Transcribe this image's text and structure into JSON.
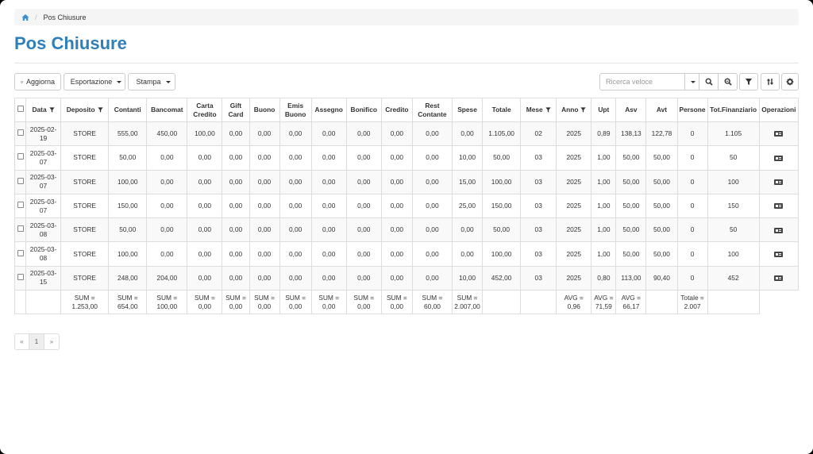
{
  "breadcrumb": {
    "current": "Pos Chiusure"
  },
  "page_title": "Pos Chiusure",
  "toolbar": {
    "refresh_label": "Aggiorna",
    "export_label": "Esportazione",
    "print_label": "Stampa",
    "search_placeholder": "Ricerca veloce"
  },
  "icons": {
    "home": "home-icon",
    "refresh": "refresh-icon",
    "export": "export-icon",
    "print": "print-icon",
    "search": "search-icon",
    "zoom": "zoom-icon",
    "filter": "filter-icon",
    "sort": "sort-icon",
    "settings": "gear-icon",
    "operation": "operation-icon"
  },
  "colors": {
    "title": "#2f7fb8",
    "accent": "#2f7fb8"
  },
  "table": {
    "headers": [
      "Data",
      "Deposito",
      "Contanti",
      "Bancomat",
      "Carta Credito",
      "Gift Card",
      "Buono",
      "Emis Buono",
      "Assegno",
      "Bonifico",
      "Credito",
      "Rest Contante",
      "Spese",
      "Totale",
      "Mese",
      "Anno",
      "Upt",
      "Asv",
      "Avt",
      "Persone",
      "Tot.Finanziario",
      "Operazioni"
    ],
    "rows": [
      [
        "2025-02-19",
        "STORE",
        "555,00",
        "450,00",
        "100,00",
        "0,00",
        "0,00",
        "0,00",
        "0,00",
        "0,00",
        "0,00",
        "0,00",
        "0,00",
        "1.105,00",
        "02",
        "2025",
        "0,89",
        "138,13",
        "122,78",
        "0",
        "1.105"
      ],
      [
        "2025-03-07",
        "STORE",
        "50,00",
        "0,00",
        "0,00",
        "0,00",
        "0,00",
        "0,00",
        "0,00",
        "0,00",
        "0,00",
        "0,00",
        "10,00",
        "50,00",
        "03",
        "2025",
        "1,00",
        "50,00",
        "50,00",
        "0",
        "50"
      ],
      [
        "2025-03-07",
        "STORE",
        "100,00",
        "0,00",
        "0,00",
        "0,00",
        "0,00",
        "0,00",
        "0,00",
        "0,00",
        "0,00",
        "0,00",
        "15,00",
        "100,00",
        "03",
        "2025",
        "1,00",
        "50,00",
        "50,00",
        "0",
        "100"
      ],
      [
        "2025-03-07",
        "STORE",
        "150,00",
        "0,00",
        "0,00",
        "0,00",
        "0,00",
        "0,00",
        "0,00",
        "0,00",
        "0,00",
        "0,00",
        "25,00",
        "150,00",
        "03",
        "2025",
        "1,00",
        "50,00",
        "50,00",
        "0",
        "150"
      ],
      [
        "2025-03-08",
        "STORE",
        "50,00",
        "0,00",
        "0,00",
        "0,00",
        "0,00",
        "0,00",
        "0,00",
        "0,00",
        "0,00",
        "0,00",
        "0,00",
        "50,00",
        "03",
        "2025",
        "1,00",
        "50,00",
        "50,00",
        "0",
        "50"
      ],
      [
        "2025-03-08",
        "STORE",
        "100,00",
        "0,00",
        "0,00",
        "0,00",
        "0,00",
        "0,00",
        "0,00",
        "0,00",
        "0,00",
        "0,00",
        "0,00",
        "100,00",
        "03",
        "2025",
        "1,00",
        "50,00",
        "50,00",
        "0",
        "100"
      ],
      [
        "2025-03-15",
        "STORE",
        "248,00",
        "204,00",
        "0,00",
        "0,00",
        "0,00",
        "0,00",
        "0,00",
        "0,00",
        "0,00",
        "0,00",
        "10,00",
        "452,00",
        "03",
        "2025",
        "0,80",
        "113,00",
        "90,40",
        "0",
        "452"
      ]
    ],
    "footer": [
      "",
      "",
      "SUM = 1.253,00",
      "SUM = 654,00",
      "SUM = 100,00",
      "SUM = 0,00",
      "SUM = 0,00",
      "SUM = 0,00",
      "SUM = 0,00",
      "SUM = 0,00",
      "SUM = 0,00",
      "SUM = 0,00",
      "SUM = 60,00",
      "SUM = 2.007,00",
      "",
      "",
      "AVG = 0,96",
      "AVG = 71,59",
      "AVG = 66,17",
      "",
      "Totale = 2.007",
      ""
    ]
  },
  "pagination": {
    "prev": "«",
    "current": "1",
    "next": "»"
  }
}
